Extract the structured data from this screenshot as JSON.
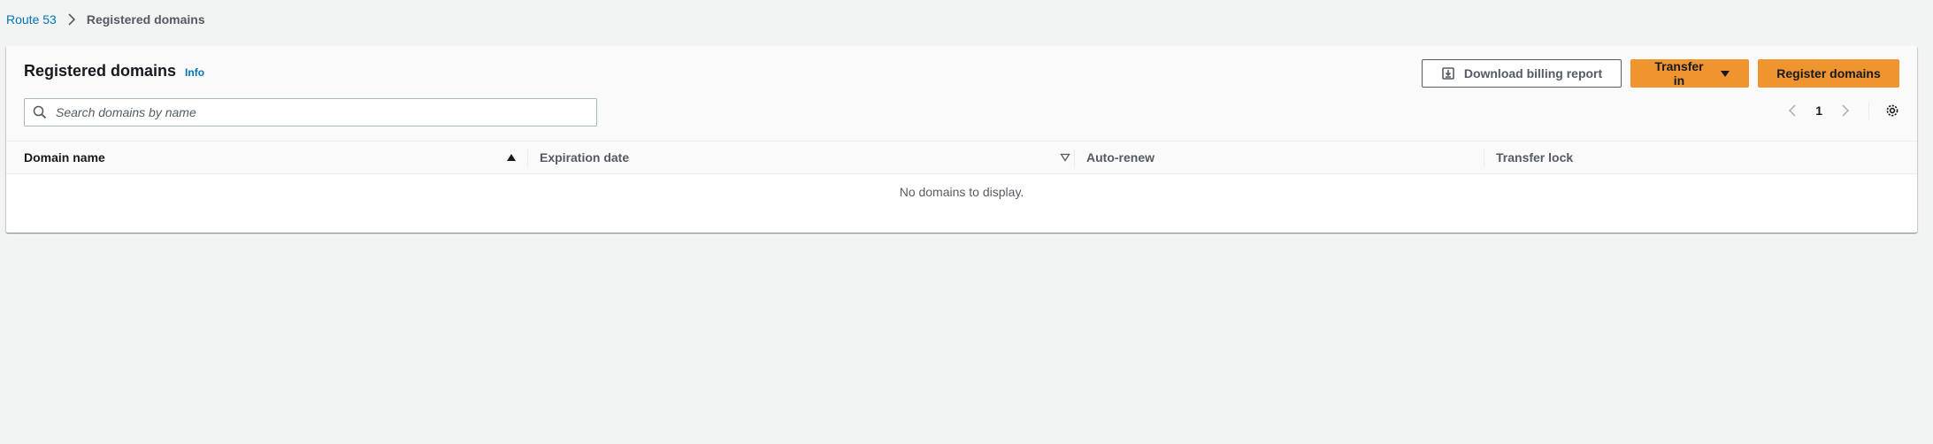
{
  "breadcrumb": {
    "root": "Route 53",
    "current": "Registered domains"
  },
  "panel": {
    "title": "Registered domains",
    "info": "Info"
  },
  "actions": {
    "download": "Download billing report",
    "transfer": "Transfer in",
    "register": "Register domains"
  },
  "search": {
    "placeholder": "Search domains by name",
    "value": ""
  },
  "pagination": {
    "current_page": "1"
  },
  "table": {
    "columns": [
      "Domain name",
      "Expiration date",
      "Auto-renew",
      "Transfer lock"
    ],
    "sorted_column": "Domain name",
    "sort_direction": "ascending",
    "empty_message": "No domains to display."
  },
  "colors": {
    "link": "#0073bb",
    "primary": "#f0942f",
    "background": "#f2f3f3"
  }
}
